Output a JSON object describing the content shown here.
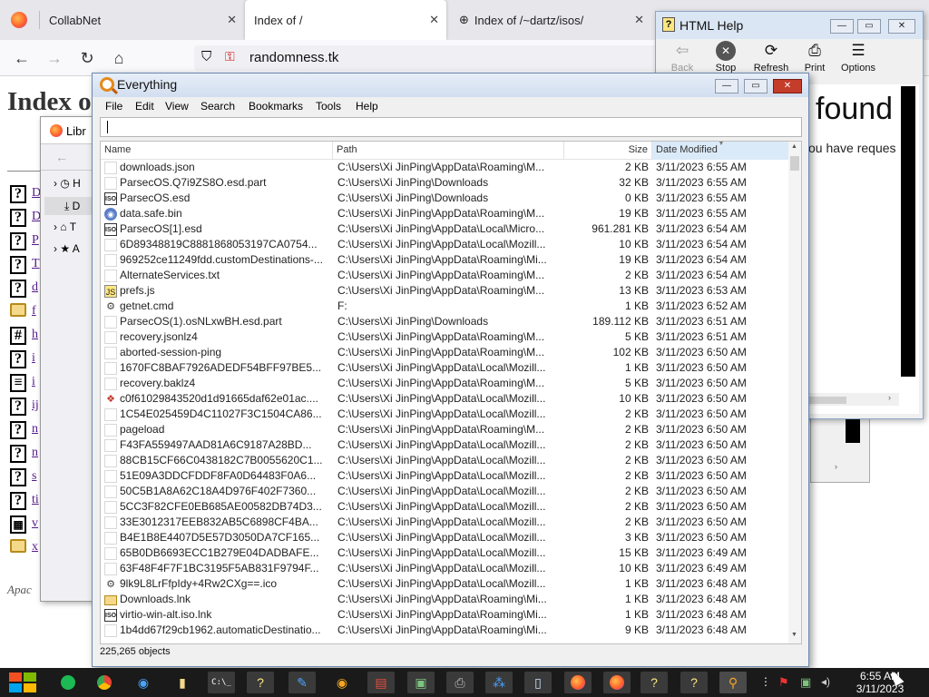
{
  "firefox": {
    "tabs": [
      {
        "label": "CollabNet",
        "active": false
      },
      {
        "label": "Index of /",
        "active": true
      },
      {
        "label": "Index of /~dartz/isos/",
        "active": false
      }
    ],
    "url": "randomness.tk",
    "page_title": "Index of",
    "footer": "Apac"
  },
  "library": {
    "title": "Libr",
    "items": [
      "H",
      "D",
      "T",
      "A"
    ]
  },
  "dir_listing": [
    {
      "icon": "help-icon",
      "label": "D"
    },
    {
      "icon": "help-icon",
      "label": "D"
    },
    {
      "icon": "help-icon",
      "label": "P"
    },
    {
      "icon": "help-icon",
      "label": "T"
    },
    {
      "icon": "help-icon",
      "label": "d"
    },
    {
      "icon": "folder-icon",
      "label": "f"
    },
    {
      "icon": "binary-icon",
      "label": "h"
    },
    {
      "icon": "help-icon",
      "label": "i"
    },
    {
      "icon": "text-icon",
      "label": "i"
    },
    {
      "icon": "help-icon",
      "label": "ij"
    },
    {
      "icon": "help-icon",
      "label": "n"
    },
    {
      "icon": "help-icon",
      "label": "n"
    },
    {
      "icon": "help-icon",
      "label": "s"
    },
    {
      "icon": "help-icon",
      "label": "ti"
    },
    {
      "icon": "film-icon",
      "label": "v"
    },
    {
      "icon": "folder-icon",
      "label": "x"
    }
  ],
  "help": {
    "title": "HTML Help",
    "toolbar": [
      "Back",
      "Stop",
      "Refresh",
      "Print",
      "Options"
    ],
    "heading_fragment": "found",
    "subtext_fragment": "ou have reques"
  },
  "everything": {
    "title": "Everything",
    "menu": [
      "File",
      "Edit",
      "View",
      "Search",
      "Bookmarks",
      "Tools",
      "Help"
    ],
    "search_value": "",
    "columns": [
      "Name",
      "Path",
      "Size",
      "Date Modified"
    ],
    "rows": [
      {
        "icon": "blank",
        "name": "downloads.json",
        "path": "C:\\Users\\Xi JinPing\\AppData\\Roaming\\M...",
        "size": "2 KB",
        "date": "3/11/2023 6:55 AM"
      },
      {
        "icon": "blank",
        "name": "ParsecOS.Q7i9ZS8O.esd.part",
        "path": "C:\\Users\\Xi JinPing\\Downloads",
        "size": "32 KB",
        "date": "3/11/2023 6:55 AM"
      },
      {
        "icon": "iso",
        "name": "ParsecOS.esd",
        "path": "C:\\Users\\Xi JinPing\\Downloads",
        "size": "0 KB",
        "date": "3/11/2023 6:55 AM"
      },
      {
        "icon": "round",
        "name": "data.safe.bin",
        "path": "C:\\Users\\Xi JinPing\\AppData\\Roaming\\M...",
        "size": "19 KB",
        "date": "3/11/2023 6:55 AM"
      },
      {
        "icon": "iso",
        "name": "ParsecOS[1].esd",
        "path": "C:\\Users\\Xi JinPing\\AppData\\Local\\Micro...",
        "size": "961.281 KB",
        "date": "3/11/2023 6:54 AM"
      },
      {
        "icon": "blank",
        "name": "6D89348819C8881868053197CA0754...",
        "path": "C:\\Users\\Xi JinPing\\AppData\\Local\\Mozill...",
        "size": "10 KB",
        "date": "3/11/2023 6:54 AM"
      },
      {
        "icon": "blank",
        "name": "969252ce11249fdd.customDestinations-...",
        "path": "C:\\Users\\Xi JinPing\\AppData\\Roaming\\Mi...",
        "size": "19 KB",
        "date": "3/11/2023 6:54 AM"
      },
      {
        "icon": "blank",
        "name": "AlternateServices.txt",
        "path": "C:\\Users\\Xi JinPing\\AppData\\Roaming\\M...",
        "size": "2 KB",
        "date": "3/11/2023 6:54 AM"
      },
      {
        "icon": "js",
        "name": "prefs.js",
        "path": "C:\\Users\\Xi JinPing\\AppData\\Roaming\\M...",
        "size": "13 KB",
        "date": "3/11/2023 6:53 AM"
      },
      {
        "icon": "gear",
        "name": "getnet.cmd",
        "path": "F:",
        "size": "1 KB",
        "date": "3/11/2023 6:52 AM"
      },
      {
        "icon": "blank",
        "name": "ParsecOS(1).osNLxwBH.esd.part",
        "path": "C:\\Users\\Xi JinPing\\Downloads",
        "size": "189.112 KB",
        "date": "3/11/2023 6:51 AM"
      },
      {
        "icon": "blank",
        "name": "recovery.jsonlz4",
        "path": "C:\\Users\\Xi JinPing\\AppData\\Roaming\\M...",
        "size": "5 KB",
        "date": "3/11/2023 6:51 AM"
      },
      {
        "icon": "blank",
        "name": "aborted-session-ping",
        "path": "C:\\Users\\Xi JinPing\\AppData\\Roaming\\M...",
        "size": "102 KB",
        "date": "3/11/2023 6:50 AM"
      },
      {
        "icon": "blank",
        "name": "1670FC8BAF7926ADEDF54BFF97BE5...",
        "path": "C:\\Users\\Xi JinPing\\AppData\\Local\\Mozill...",
        "size": "1 KB",
        "date": "3/11/2023 6:50 AM"
      },
      {
        "icon": "blank",
        "name": "recovery.baklz4",
        "path": "C:\\Users\\Xi JinPing\\AppData\\Roaming\\M...",
        "size": "5 KB",
        "date": "3/11/2023 6:50 AM"
      },
      {
        "icon": "pic",
        "name": "c0f61029843520d1d91665daf62e01ac....",
        "path": "C:\\Users\\Xi JinPing\\AppData\\Local\\Mozill...",
        "size": "10 KB",
        "date": "3/11/2023 6:50 AM"
      },
      {
        "icon": "blank",
        "name": "1C54E025459D4C11027F3C1504CA86...",
        "path": "C:\\Users\\Xi JinPing\\AppData\\Local\\Mozill...",
        "size": "2 KB",
        "date": "3/11/2023 6:50 AM"
      },
      {
        "icon": "blank",
        "name": "pageload",
        "path": "C:\\Users\\Xi JinPing\\AppData\\Roaming\\M...",
        "size": "2 KB",
        "date": "3/11/2023 6:50 AM"
      },
      {
        "icon": "blank",
        "name": "F43FA559497AAD81A6C9187A28BD...",
        "path": "C:\\Users\\Xi JinPing\\AppData\\Local\\Mozill...",
        "size": "2 KB",
        "date": "3/11/2023 6:50 AM"
      },
      {
        "icon": "blank",
        "name": "88CB15CF66C0438182C7B0055620C1...",
        "path": "C:\\Users\\Xi JinPing\\AppData\\Local\\Mozill...",
        "size": "2 KB",
        "date": "3/11/2023 6:50 AM"
      },
      {
        "icon": "blank",
        "name": "51E09A3DDCFDDF8FA0D64483F0A6...",
        "path": "C:\\Users\\Xi JinPing\\AppData\\Local\\Mozill...",
        "size": "2 KB",
        "date": "3/11/2023 6:50 AM"
      },
      {
        "icon": "blank",
        "name": "50C5B1A8A62C18A4D976F402F7360...",
        "path": "C:\\Users\\Xi JinPing\\AppData\\Local\\Mozill...",
        "size": "2 KB",
        "date": "3/11/2023 6:50 AM"
      },
      {
        "icon": "blank",
        "name": "5CC3F82CFE0EB685AE00582DB74D3...",
        "path": "C:\\Users\\Xi JinPing\\AppData\\Local\\Mozill...",
        "size": "2 KB",
        "date": "3/11/2023 6:50 AM"
      },
      {
        "icon": "blank",
        "name": "33E3012317EEB832AB5C6898CF4BA...",
        "path": "C:\\Users\\Xi JinPing\\AppData\\Local\\Mozill...",
        "size": "2 KB",
        "date": "3/11/2023 6:50 AM"
      },
      {
        "icon": "blank",
        "name": "B4E1B8E4407D5E57D3050DA7CF165...",
        "path": "C:\\Users\\Xi JinPing\\AppData\\Local\\Mozill...",
        "size": "3 KB",
        "date": "3/11/2023 6:50 AM"
      },
      {
        "icon": "blank",
        "name": "65B0DB6693ECC1B279E04DADBAFE...",
        "path": "C:\\Users\\Xi JinPing\\AppData\\Local\\Mozill...",
        "size": "15 KB",
        "date": "3/11/2023 6:49 AM"
      },
      {
        "icon": "blank",
        "name": "63F48F4F7F1BC3195F5AB831F9794F...",
        "path": "C:\\Users\\Xi JinPing\\AppData\\Local\\Mozill...",
        "size": "10 KB",
        "date": "3/11/2023 6:49 AM"
      },
      {
        "icon": "gear",
        "name": "9lk9L8LrFfpIdy+4Rw2CXg==.ico",
        "path": "C:\\Users\\Xi JinPing\\AppData\\Local\\Mozill...",
        "size": "1 KB",
        "date": "3/11/2023 6:48 AM"
      },
      {
        "icon": "folder",
        "name": "Downloads.lnk",
        "path": "C:\\Users\\Xi JinPing\\AppData\\Roaming\\Mi...",
        "size": "1 KB",
        "date": "3/11/2023 6:48 AM"
      },
      {
        "icon": "iso",
        "name": "virtio-win-alt.iso.lnk",
        "path": "C:\\Users\\Xi JinPing\\AppData\\Roaming\\Mi...",
        "size": "1 KB",
        "date": "3/11/2023 6:48 AM"
      },
      {
        "icon": "blank",
        "name": "1b4dd67f29cb1962.automaticDestinatio...",
        "path": "C:\\Users\\Xi JinPing\\AppData\\Roaming\\Mi...",
        "size": "9 KB",
        "date": "3/11/2023 6:48 AM"
      }
    ],
    "status": "225,265 objects"
  },
  "taskbar": {
    "time": "6:55 AM",
    "date": "3/11/2023"
  }
}
